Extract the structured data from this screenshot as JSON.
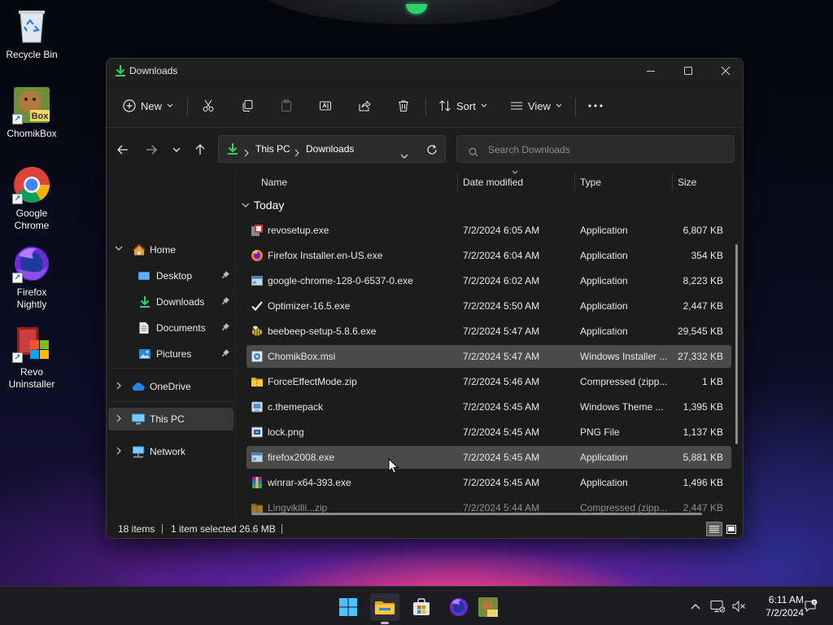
{
  "colors": {
    "window_bg": "#1c1c1c",
    "titlebar_bg": "#202020",
    "selected_row": "#4a4a4a",
    "accent_green": "#2ed16b",
    "taskbar_bg": "#1c1c22"
  },
  "desktop": {
    "icons": [
      {
        "label": "Recycle Bin",
        "icon": "recycle-bin-icon"
      },
      {
        "label": "ChomikBox",
        "icon": "chomikbox-icon"
      },
      {
        "label": "Google Chrome",
        "icon": "chrome-icon"
      },
      {
        "label": "Firefox Nightly",
        "icon": "firefox-nightly-icon"
      },
      {
        "label": "Revo Uninstaller",
        "icon": "revo-uninstaller-icon"
      }
    ]
  },
  "window": {
    "title": "Downloads",
    "controls": [
      "minimize",
      "maximize",
      "close"
    ]
  },
  "commandbar": {
    "new_label": "New",
    "sort_label": "Sort",
    "view_label": "View",
    "icons": [
      "new-icon",
      "cut-icon",
      "copy-icon",
      "paste-icon",
      "rename-icon",
      "share-icon",
      "delete-icon",
      "sort-icon",
      "view-icon",
      "more-icon"
    ]
  },
  "navigation": {
    "breadcrumbs": [
      "This PC",
      "Downloads"
    ],
    "search_placeholder": "Search Downloads"
  },
  "sidebar": {
    "items": [
      {
        "label": "Home",
        "icon": "home-icon",
        "expandable": true
      },
      {
        "label": "Desktop",
        "icon": "desktop-folder-icon",
        "pinned": true
      },
      {
        "label": "Downloads",
        "icon": "downloads-folder-icon",
        "pinned": true
      },
      {
        "label": "Documents",
        "icon": "documents-folder-icon",
        "pinned": true
      },
      {
        "label": "Pictures",
        "icon": "pictures-folder-icon",
        "pinned": true
      },
      {
        "label": "OneDrive",
        "icon": "onedrive-icon",
        "expandable": true
      },
      {
        "label": "This PC",
        "icon": "this-pc-icon",
        "expandable": true,
        "selected": true
      },
      {
        "label": "Network",
        "icon": "network-icon",
        "expandable": true
      }
    ]
  },
  "filelist": {
    "columns": {
      "name": "Name",
      "date": "Date modified",
      "type": "Type",
      "size": "Size"
    },
    "group": "Today",
    "rows": [
      {
        "name": "revosetup.exe",
        "date": "7/2/2024 6:05 AM",
        "type": "Application",
        "size": "6,807 KB",
        "icon": "installer-icon"
      },
      {
        "name": "Firefox Installer.en-US.exe",
        "date": "7/2/2024 6:04 AM",
        "type": "Application",
        "size": "354 KB",
        "icon": "firefox-icon"
      },
      {
        "name": "google-chrome-128-0-6537-0.exe",
        "date": "7/2/2024 6:02 AM",
        "type": "Application",
        "size": "8,223 KB",
        "icon": "exe-icon"
      },
      {
        "name": "Optimizer-16.5.exe",
        "date": "7/2/2024 5:50 AM",
        "type": "Application",
        "size": "2,447 KB",
        "icon": "checkmark-icon"
      },
      {
        "name": "beebeep-setup-5.8.6.exe",
        "date": "7/2/2024 5:47 AM",
        "type": "Application",
        "size": "29,545 KB",
        "icon": "bee-icon"
      },
      {
        "name": "ChomikBox.msi",
        "date": "7/2/2024 5:47 AM",
        "type": "Windows Installer ...",
        "size": "27,332 KB",
        "icon": "msi-icon",
        "selected": true
      },
      {
        "name": "ForceEffectMode.zip",
        "date": "7/2/2024 5:46 AM",
        "type": "Compressed (zipp...",
        "size": "1 KB",
        "icon": "zip-folder-icon"
      },
      {
        "name": "c.themepack",
        "date": "7/2/2024 5:45 AM",
        "type": "Windows Theme ...",
        "size": "1,395 KB",
        "icon": "themepack-icon"
      },
      {
        "name": "lock.png",
        "date": "7/2/2024 5:45 AM",
        "type": "PNG File",
        "size": "1,137 KB",
        "icon": "image-file-icon"
      },
      {
        "name": "firefox2008.exe",
        "date": "7/2/2024 5:45 AM",
        "type": "Application",
        "size": "5,881 KB",
        "icon": "exe-icon",
        "hover": true
      },
      {
        "name": "winrar-x64-393.exe",
        "date": "7/2/2024 5:45 AM",
        "type": "Application",
        "size": "1,496 KB",
        "icon": "winrar-icon"
      },
      {
        "name": "Lingvikilli...zip",
        "date": "7/2/2024 5:44 AM",
        "type": "Compressed (zipp...",
        "size": "2,447 KB",
        "icon": "zip-folder-icon"
      }
    ]
  },
  "status": {
    "items_count": "18 items",
    "selection": "1 item selected  26.6 MB"
  },
  "taskbar": {
    "apps": [
      "start-icon",
      "file-explorer-icon",
      "store-icon",
      "firefox-nightly-icon",
      "chomikbox-icon"
    ],
    "tray": [
      "chevron-up-icon",
      "network-tray-icon",
      "volume-muted-icon",
      "notification-icon"
    ],
    "time": "6:11 AM",
    "date": "7/2/2024"
  }
}
